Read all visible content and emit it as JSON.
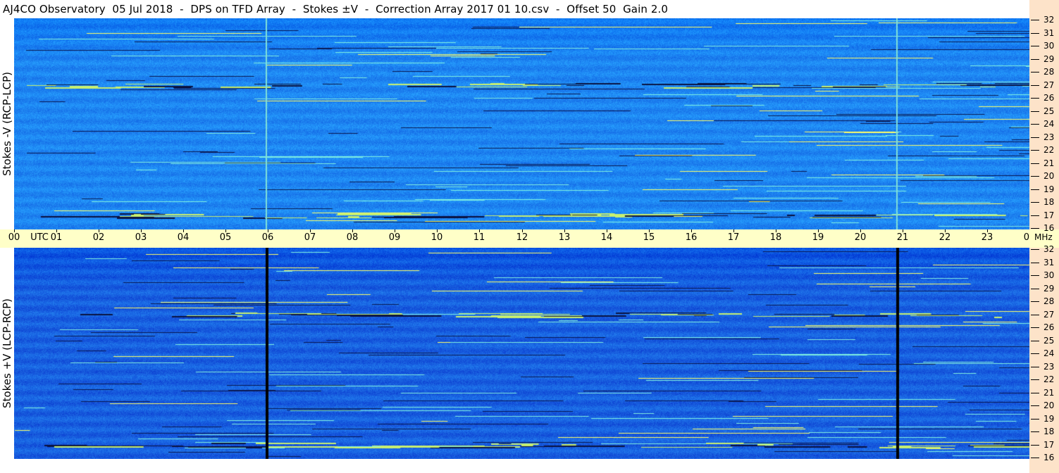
{
  "header": {
    "title": "AJ4CO Observatory  05 Jul 2018  -  DPS on TFD Array  -  Stokes ±V  -  Correction Array 2017 01 10.csv  -  Offset 50  Gain 2.0"
  },
  "chart_data": [
    {
      "type": "heatmap",
      "ylabel": "Stokes -V (RCP-LCP)",
      "xlabel": "UTC",
      "x_ticks": [
        "00",
        "UTC",
        "01",
        "02",
        "03",
        "04",
        "05",
        "06",
        "07",
        "08",
        "09",
        "10",
        "11",
        "12",
        "13",
        "14",
        "15",
        "16",
        "17",
        "18",
        "19",
        "20",
        "21",
        "22",
        "23",
        "00"
      ],
      "y_ticks": [
        "32",
        "31",
        "30",
        "29",
        "28",
        "27",
        "26",
        "25",
        "24",
        "23",
        "22",
        "21",
        "20",
        "19",
        "18",
        "17",
        "16"
      ],
      "y_unit": "MHz",
      "x_range": [
        0,
        24
      ],
      "y_range": [
        16,
        32
      ],
      "base_color": "#1f86f2",
      "vertical_lines": [
        {
          "time": 5.95,
          "color": "#7fe0d8"
        },
        {
          "time": 20.85,
          "color": "#7fe0d8"
        }
      ],
      "bright_bands_mhz": [
        27.0,
        17.0
      ]
    },
    {
      "type": "heatmap",
      "ylabel": "Stokes +V (LCP-RCP)",
      "x_range": [
        0,
        24
      ],
      "y_range": [
        16,
        32
      ],
      "base_color": "#1660df",
      "vertical_lines": [
        {
          "time": 5.95,
          "color": "#000000"
        },
        {
          "time": 20.85,
          "color": "#000000"
        }
      ],
      "bright_bands_mhz": [
        27.0,
        17.0
      ]
    }
  ],
  "axis": {
    "mhz_label": "MHz",
    "freq_labels": [
      "32",
      "31",
      "30",
      "29",
      "28",
      "27",
      "26",
      "25",
      "24",
      "23",
      "22",
      "21",
      "20",
      "19",
      "18",
      "17",
      "16"
    ]
  }
}
